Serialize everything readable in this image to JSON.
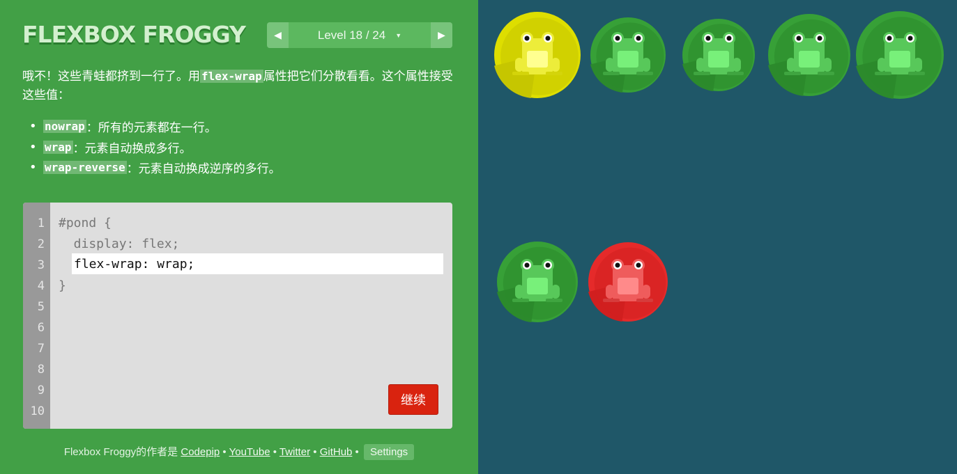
{
  "app": {
    "title": "FLEXBOX FROGGY"
  },
  "level_nav": {
    "prev_icon": "triangle-left-icon",
    "next_icon": "triangle-right-icon",
    "label": "Level 18 / 24",
    "caret": "▼"
  },
  "instructions": {
    "intro_before": "哦不！这些青蛙都挤到一行了。用",
    "intro_code": "flex-wrap",
    "intro_after": "属性把它们分散看看。这个属性接受这些值：",
    "values": [
      {
        "code": "nowrap",
        "text": "：所有的元素都在一行。"
      },
      {
        "code": "wrap",
        "text": "：元素自动换成多行。"
      },
      {
        "code": "wrap-reverse",
        "text": "：元素自动换成逆序的多行。"
      }
    ]
  },
  "editor": {
    "line_numbers": [
      "1",
      "2",
      "3",
      "4",
      "5",
      "6",
      "7",
      "8",
      "9",
      "10"
    ],
    "line1": "#pond {",
    "line2": "  display: flex;",
    "input_value": "flex-wrap: wrap;",
    "line4": "}",
    "next_button": "继续"
  },
  "footer": {
    "prefix": "Flexbox Froggy的作者是",
    "author": "Codepip",
    "sep": "•",
    "links": [
      "YouTube",
      "Twitter",
      "GitHub"
    ],
    "settings": "Settings"
  },
  "colors": {
    "sidebar": "#42a046",
    "pond": "#1f5768",
    "yellow_pad": "#c6c600",
    "yellow_frog": "#eded3a",
    "green_pad": "#2c8a2c",
    "green_frog": "#58c85a",
    "red_pad": "#d11f1f",
    "red_frog": "#ef5c5c"
  },
  "pond": {
    "frogs": [
      {
        "color": "yellow"
      },
      {
        "color": "green"
      },
      {
        "color": "green"
      },
      {
        "color": "green"
      },
      {
        "color": "green"
      },
      {
        "color": "green"
      },
      {
        "color": "red"
      }
    ]
  }
}
